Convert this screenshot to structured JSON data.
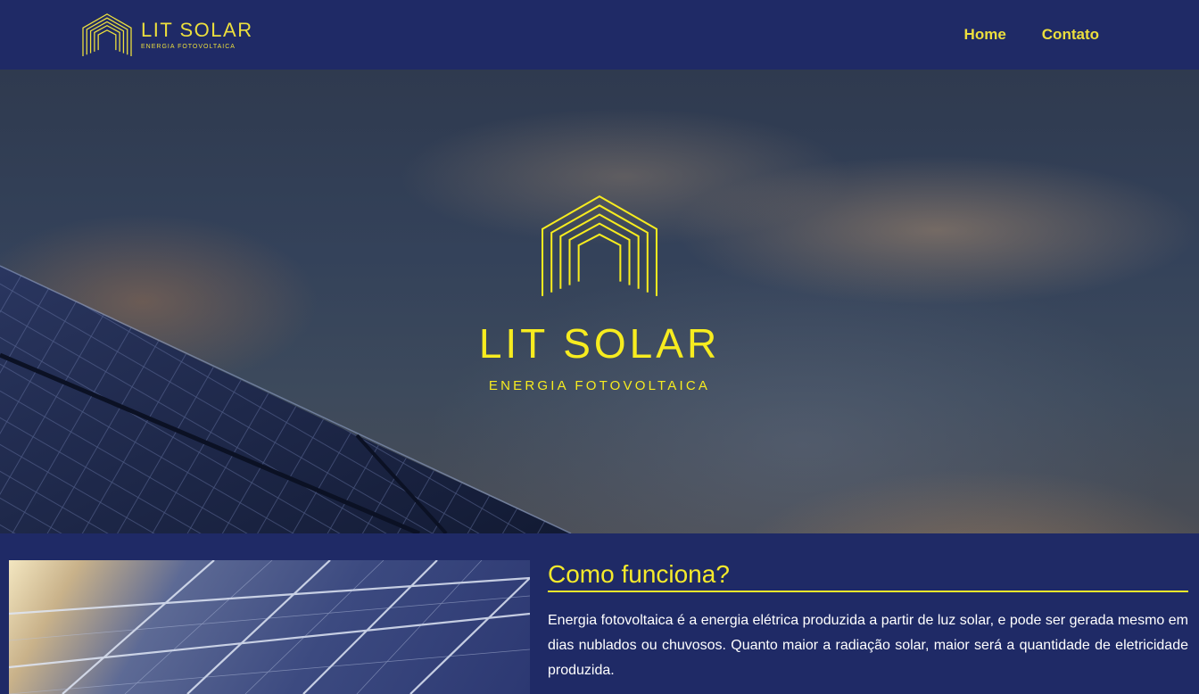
{
  "navbar": {
    "logo": {
      "title": "LIT SOLAR",
      "subtitle": "ENERGIA FOTOVOLTAICA",
      "icon": "house-lines-icon"
    },
    "links": [
      {
        "label": "Home"
      },
      {
        "label": "Contato"
      }
    ]
  },
  "hero": {
    "title": "LIT SOLAR",
    "subtitle": "ENERGIA FOTOVOLTAICA",
    "icon": "house-lines-icon"
  },
  "about": {
    "heading": "Como funciona?",
    "body": "Energia fotovoltaica é a energia elétrica produzida a partir de luz solar, e pode ser gerada mesmo em dias nublados ou chuvosos. Quanto maior a radiação solar, maior será a quantidade de eletricidade produzida."
  },
  "colors": {
    "navy": "#1f2a66",
    "accent_yellow": "#f7ec1f",
    "text_white": "#ffffff"
  }
}
